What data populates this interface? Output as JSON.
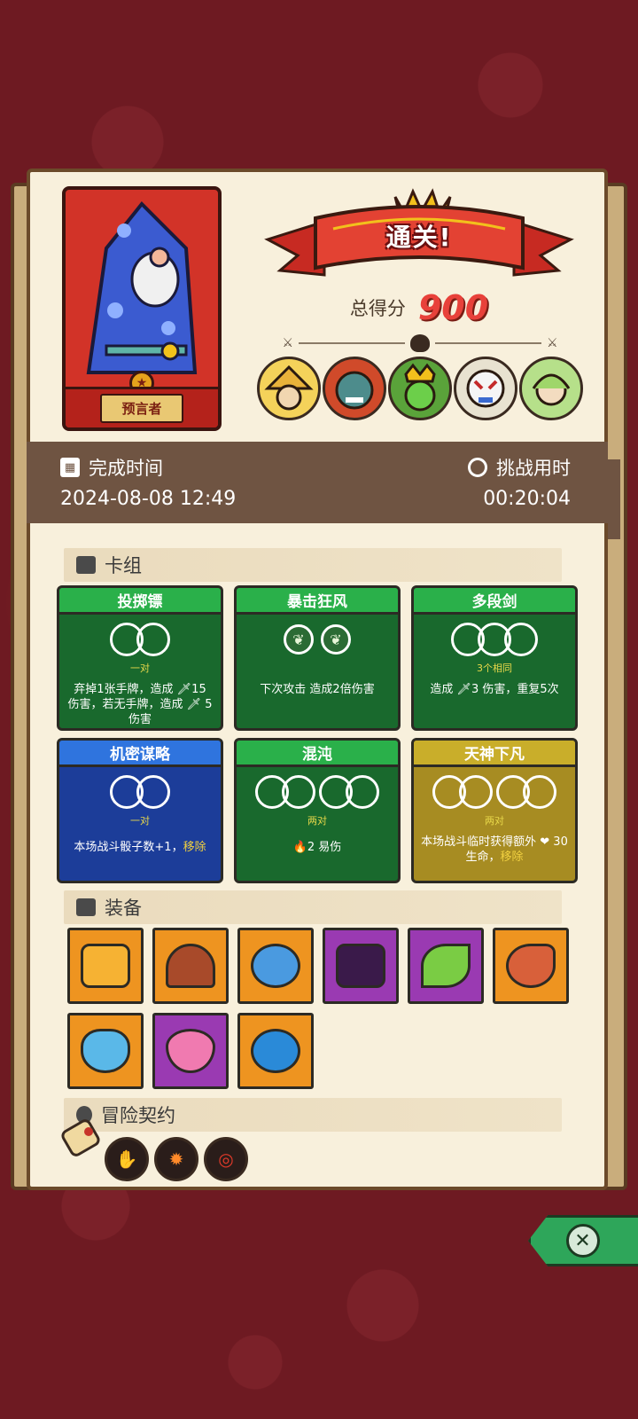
{
  "hero": {
    "name": "预言者",
    "icon": "wizard-portrait",
    "color": "#d23328"
  },
  "result": {
    "banner": "通关!",
    "score_label": "总得分",
    "score_value": "900"
  },
  "bosses": [
    {
      "icon": "straw-hat-boss",
      "color": "#f4d25a"
    },
    {
      "icon": "red-ogre-boss",
      "color": "#d04a2a"
    },
    {
      "icon": "green-demon-king-boss",
      "color": "#5aa33a"
    },
    {
      "icon": "white-tiger-boss",
      "color": "#e8e2d0"
    },
    {
      "icon": "elf-queen-boss",
      "color": "#b6e08a"
    }
  ],
  "time": {
    "completion_label": "完成时间",
    "completion_value": "2024-08-08 12:49",
    "challenge_label": "挑战用时",
    "challenge_value": "00:20:04"
  },
  "deck": {
    "header": "卡组",
    "cards": [
      {
        "title": "投掷镖",
        "requirement": "一对",
        "desc": "弃掉1张手牌，造成 🗡15 伤害，若无手牌，造成 🗡 5 伤害",
        "rarity": "green"
      },
      {
        "title": "暴击狂风",
        "requirement": "",
        "desc": "下次攻击 造成2倍伤害",
        "rarity": "green"
      },
      {
        "title": "多段剑",
        "requirement": "3个相同",
        "desc": "造成 🗡3 伤害，重复5次",
        "rarity": "green"
      },
      {
        "title": "机密谋略",
        "requirement": "一对",
        "desc_prefix": "本场战斗骰子数+1，",
        "desc_hl": "移除",
        "rarity": "blue"
      },
      {
        "title": "混沌",
        "requirement": "两对",
        "desc": "🔥2 易伤",
        "rarity": "green"
      },
      {
        "title": "天神下凡",
        "requirement": "两对",
        "desc_prefix": "本场战斗临时获得额外 ❤ 30 生命，",
        "desc_hl": "移除",
        "rarity": "gold"
      }
    ]
  },
  "equipment": {
    "header": "装备",
    "items": [
      {
        "icon": "poncho-icon",
        "rarity": "orange",
        "color": "#f6b233"
      },
      {
        "icon": "hood-icon",
        "rarity": "orange",
        "color": "#a84a2a"
      },
      {
        "icon": "blue-mushroom-icon",
        "rarity": "orange",
        "color": "#4a9ae0"
      },
      {
        "icon": "dark-armor-icon",
        "rarity": "purple",
        "color": "#3a1a4a"
      },
      {
        "icon": "herb-leaves-icon",
        "rarity": "purple",
        "color": "#7acc44"
      },
      {
        "icon": "ham-leg-icon",
        "rarity": "orange",
        "color": "#d8603a"
      },
      {
        "icon": "ice-skull-shield-icon",
        "rarity": "orange",
        "color": "#5ab8e8"
      },
      {
        "icon": "heart-amulet-icon",
        "rarity": "purple",
        "color": "#f07ab0"
      },
      {
        "icon": "swirl-orb-icon",
        "rarity": "orange",
        "color": "#2a8ad8"
      }
    ]
  },
  "contract": {
    "header": "冒险契约",
    "icons": [
      "scroll-icon",
      "paw-badge-icon",
      "fire-badge-icon",
      "spiral-badge-icon"
    ]
  }
}
